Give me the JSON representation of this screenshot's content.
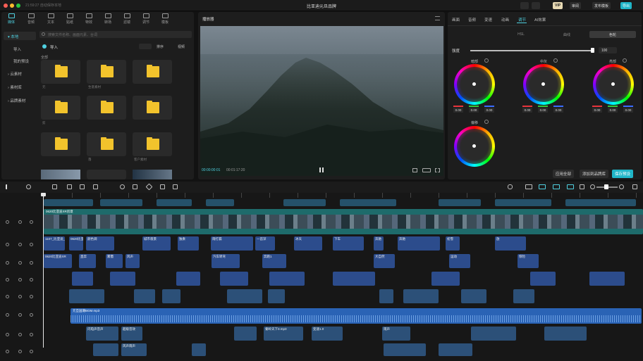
{
  "titlebar": {
    "title": "比亚迪元旦品牌",
    "save_status": "21:59:27 自动保存本地",
    "pro_label": "VIP",
    "review_label": "审阅",
    "publish_template_label": "发布模板",
    "export_label": "导出"
  },
  "media": {
    "tabs": [
      {
        "label": "媒体",
        "icon": "media-icon"
      },
      {
        "label": "音频",
        "icon": "audio-icon"
      },
      {
        "label": "文本",
        "icon": "text-icon"
      },
      {
        "label": "贴纸",
        "icon": "sticker-icon"
      },
      {
        "label": "特效",
        "icon": "effects-icon"
      },
      {
        "label": "转场",
        "icon": "transition-icon"
      },
      {
        "label": "滤镜",
        "icon": "filter-icon"
      },
      {
        "label": "调节",
        "icon": "adjust-icon"
      },
      {
        "label": "模板",
        "icon": "template-icon"
      }
    ],
    "sidebar": [
      "▾ 本地",
      "导入",
      "我的预设",
      "› 云素材",
      "› 素材库",
      "› 品牌素材"
    ],
    "search_placeholder": "搜索文件名称、画面元素、台词",
    "import_label": "导入",
    "sort_label": "排序",
    "view_label": "视频",
    "all_label": "全部",
    "folders": [
      "元",
      "生意素材",
      "",
      "剪",
      "",
      "",
      "",
      "落",
      "客户素材"
    ]
  },
  "player": {
    "title": "播放器",
    "time_current": "00:00:00:01",
    "time_total": "00:01:17:20"
  },
  "inspector": {
    "tabs": [
      "画面",
      "音频",
      "变速",
      "动画",
      "调节",
      "AI效果"
    ],
    "active_tab": "调节",
    "subtabs": [
      "",
      "HSL",
      "曲线",
      "色轮"
    ],
    "active_subtab": "色轮",
    "strength_label": "强度",
    "strength_value": "100",
    "wheels": [
      {
        "label": "暗部"
      },
      {
        "label": "中灰"
      },
      {
        "label": "亮部"
      },
      {
        "label": "偏移"
      }
    ],
    "zero": "0.00",
    "apply_all_label": "应用全部",
    "add_preset_label": "添加到品牌库",
    "save_preset_label": "保存预设"
  },
  "timeline": {
    "main_track_label": "0620比亚迪XR创意",
    "clips_row1": [
      "1107_比亚迪_0",
      "0620比亚迪XR",
      "颜色调",
      "城市夜景",
      "独奏",
      "雨打漏",
      "一首深",
      "冰天",
      "下车",
      "奔驰",
      "奔驰",
      "初雪",
      "放"
    ],
    "clips_row2": [
      "0620比亚迪XR",
      "直奔",
      "雾霭",
      "风声",
      "汽车转弯",
      "奔跑1",
      "大自然",
      "运动",
      "惊险"
    ],
    "audio_label": "元旦国潮BGM.mp3",
    "sfx": [
      "闪电声音声",
      "超级音效",
      "秦岭天下3.mp3",
      "变速1.0",
      "雨声",
      "风声雨声"
    ]
  },
  "colors": {
    "accent": "#4fd0e0",
    "folder": "#f2c32c",
    "clip_blue": "#2c4c8c",
    "audio_blue": "#2a63b5",
    "main_track": "#1e6b6b"
  }
}
